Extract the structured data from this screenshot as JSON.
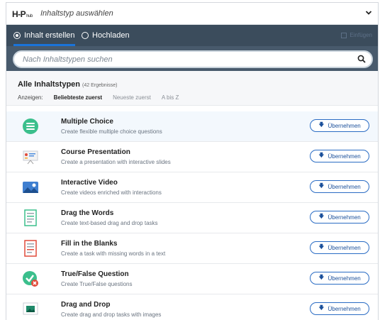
{
  "header": {
    "logo": "H-P",
    "logo_suffix": "hub",
    "title": "Inhaltstyp auswählen"
  },
  "tabs": [
    {
      "label": "Inhalt erstellen",
      "selected": true
    },
    {
      "label": "Hochladen",
      "selected": false
    }
  ],
  "insert_label": "Einfügen",
  "search": {
    "placeholder": "Nach Inhaltstypen suchen",
    "value": ""
  },
  "filter": {
    "all_label": "Alle Inhaltstypen",
    "count": "(42 Ergebnisse)",
    "show_label": "Anzeigen:",
    "sort_options": [
      "Beliebteste zuerst",
      "Neueste zuerst",
      "A bis Z"
    ],
    "selected_sort": "Beliebteste zuerst"
  },
  "items": [
    {
      "name": "Multiple Choice",
      "desc": "Create flexible multiple choice questions",
      "btn": "Übernehmen",
      "icon": "multiple-choice-icon"
    },
    {
      "name": "Course Presentation",
      "desc": "Create a presentation with interactive slides",
      "btn": "Übernehmen",
      "icon": "course-presentation-icon"
    },
    {
      "name": "Interactive Video",
      "desc": "Create videos enriched with interactions",
      "btn": "Übernehmen",
      "icon": "interactive-video-icon"
    },
    {
      "name": "Drag the Words",
      "desc": "Create text-based drag and drop tasks",
      "btn": "Übernehmen",
      "icon": "drag-the-words-icon"
    },
    {
      "name": "Fill in the Blanks",
      "desc": "Create a task with missing words in a text",
      "btn": "Übernehmen",
      "icon": "fill-in-the-blanks-icon"
    },
    {
      "name": "True/False Question",
      "desc": "Create True/False questions",
      "btn": "Übernehmen",
      "icon": "true-false-icon"
    },
    {
      "name": "Drag and Drop",
      "desc": "Create drag and drop tasks with images",
      "btn": "Übernehmen",
      "icon": "drag-and-drop-icon"
    }
  ],
  "colors": {
    "tabbar": "#3b4c5c",
    "searchband": "#485a6c",
    "accent": "#1a73d9",
    "button_border": "#2a6cc4"
  }
}
